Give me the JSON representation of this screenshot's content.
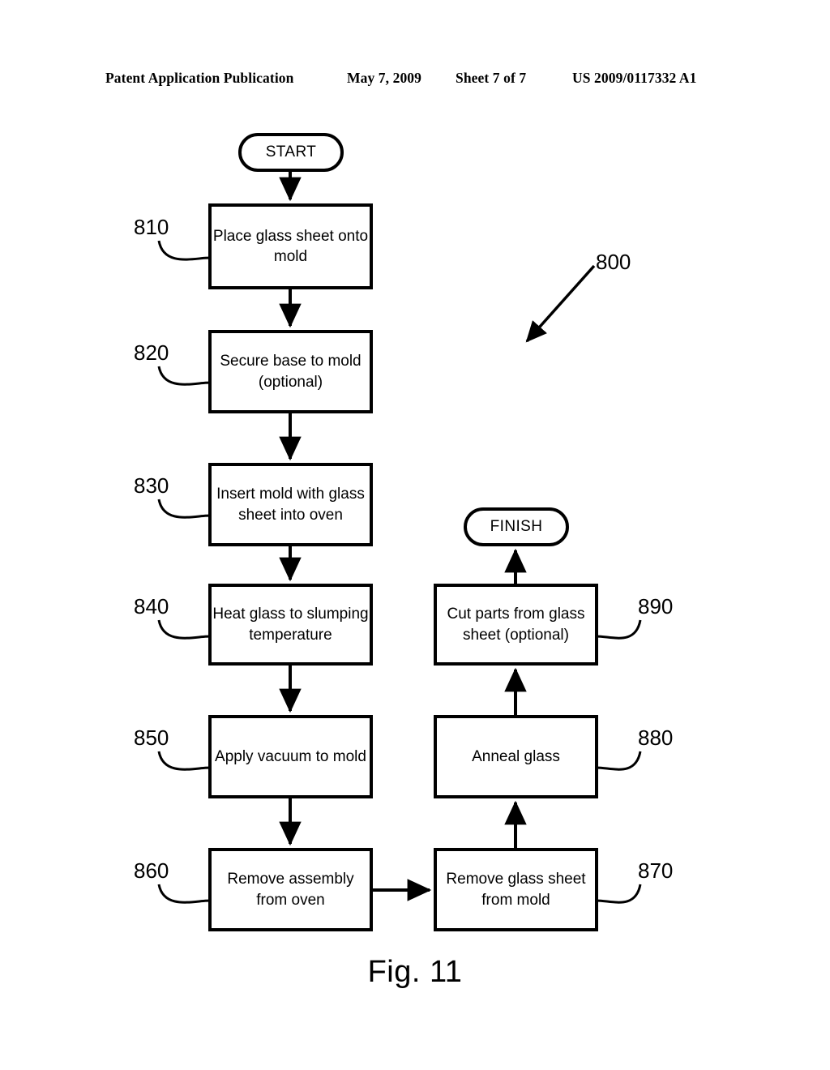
{
  "header": {
    "publication": "Patent Application Publication",
    "date": "May 7, 2009",
    "sheet": "Sheet 7 of 7",
    "patent_number": "US 2009/0117332 A1"
  },
  "figure": {
    "caption": "Fig. 11",
    "diagram_reference": "800",
    "terminators": {
      "start": "START",
      "finish": "FINISH"
    },
    "steps": [
      {
        "ref": "810",
        "text": "Place glass sheet onto mold",
        "column": "left",
        "ref_side": "left"
      },
      {
        "ref": "820",
        "text": "Secure base to mold (optional)",
        "column": "left",
        "ref_side": "left"
      },
      {
        "ref": "830",
        "text": "Insert mold with glass sheet into oven",
        "column": "left",
        "ref_side": "left"
      },
      {
        "ref": "840",
        "text": "Heat glass to slumping temperature",
        "column": "left",
        "ref_side": "left"
      },
      {
        "ref": "850",
        "text": "Apply vacuum to mold",
        "column": "left",
        "ref_side": "left"
      },
      {
        "ref": "860",
        "text": "Remove assembly from oven",
        "column": "left",
        "ref_side": "left"
      },
      {
        "ref": "870",
        "text": "Remove glass sheet from mold",
        "column": "right",
        "ref_side": "right"
      },
      {
        "ref": "880",
        "text": "Anneal glass",
        "column": "right",
        "ref_side": "right"
      },
      {
        "ref": "890",
        "text": "Cut parts from glass sheet (optional)",
        "column": "right",
        "ref_side": "right"
      }
    ],
    "step_lines": {
      "810": [
        "Place glass sheet onto",
        "mold"
      ],
      "820": [
        "Secure base to mold",
        "(optional)"
      ],
      "830": [
        "Insert mold with glass",
        "sheet into oven"
      ],
      "840": [
        "Heat glass to slumping",
        "temperature"
      ],
      "850": [
        "Apply vacuum to mold"
      ],
      "860": [
        "Remove assembly",
        "from oven"
      ],
      "870": [
        "Remove glass sheet",
        "from mold"
      ],
      "880": [
        "Anneal glass"
      ],
      "890": [
        "Cut parts from glass",
        "sheet (optional)"
      ]
    },
    "colors": {
      "ink": "#000000",
      "paper": "#ffffff"
    }
  }
}
